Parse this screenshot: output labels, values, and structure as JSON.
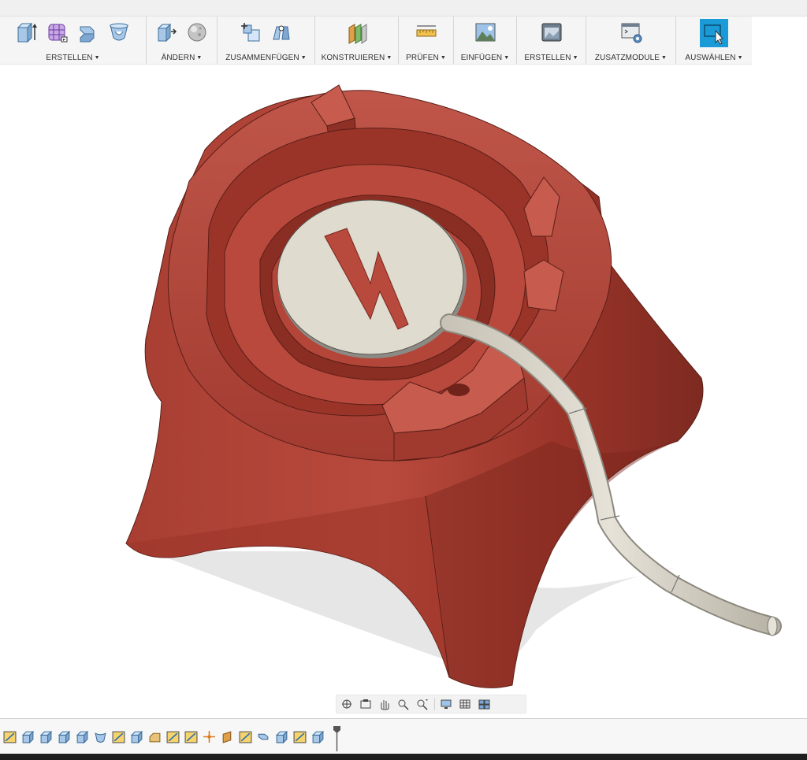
{
  "toolbar": {
    "groups": [
      {
        "label": "ERSTELLEN",
        "icons": [
          "extrude-icon",
          "form-icon",
          "sweep-icon",
          "revolve-icon"
        ]
      },
      {
        "label": "ÄNDERN",
        "icons": [
          "press-pull-icon",
          "appearance-icon"
        ]
      },
      {
        "label": "ZUSAMMENFÜGEN",
        "icons": [
          "new-component-icon",
          "joint-icon"
        ]
      },
      {
        "label": "KONSTRUIEREN",
        "icons": [
          "offset-plane-icon"
        ]
      },
      {
        "label": "PRÜFEN",
        "icons": [
          "measure-icon"
        ]
      },
      {
        "label": "EINFÜGEN",
        "icons": [
          "insert-image-icon"
        ]
      },
      {
        "label": "ERSTELLEN",
        "icons": [
          "render-icon"
        ]
      },
      {
        "label": "ZUSATZMODULE",
        "icons": [
          "scripts-icon"
        ]
      },
      {
        "label": "AUSWÄHLEN",
        "icons": [
          "select-icon"
        ]
      }
    ]
  },
  "navbar": {
    "buttons": [
      "orbit-icon",
      "look-at-icon",
      "pan-icon",
      "zoom-icon",
      "fit-icon",
      "display-settings-icon",
      "grid-icon",
      "viewports-icon"
    ]
  },
  "timeline": {
    "items": [
      "sketch",
      "extrude",
      "extrude",
      "extrude",
      "extrude",
      "revolve",
      "sketch",
      "extrude",
      "chamfer",
      "sketch",
      "sketch",
      "point",
      "plane",
      "sketch",
      "sweep",
      "extrude",
      "sketch",
      "extrude"
    ]
  },
  "colors": {
    "model_red": "#b84a3d",
    "model_dark": "#8e3026",
    "disc": "#e0dbcf",
    "cable": "#d8d3c6",
    "accent_select": "#1a9bd7"
  }
}
